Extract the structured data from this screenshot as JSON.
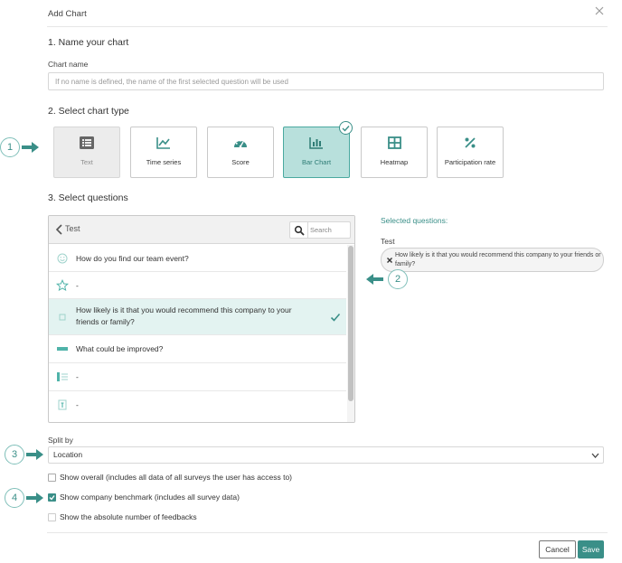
{
  "dialog": {
    "title": "Add Chart"
  },
  "section1": {
    "title": "1. Name your chart",
    "label": "Chart name",
    "placeholder": "If no name is defined, the name of the first selected question will be used",
    "value": ""
  },
  "section2": {
    "title": "2. Select chart type",
    "chart_types": [
      {
        "label": "Text",
        "icon": "list-icon",
        "state": "disabled"
      },
      {
        "label": "Time series",
        "icon": "line-chart-icon",
        "state": "normal"
      },
      {
        "label": "Score",
        "icon": "gauge-icon",
        "state": "normal"
      },
      {
        "label": "Bar Chart",
        "icon": "bar-chart-icon",
        "state": "selected"
      },
      {
        "label": "Heatmap",
        "icon": "grid-icon",
        "state": "normal"
      },
      {
        "label": "Participation rate",
        "icon": "percent-icon",
        "state": "normal"
      }
    ]
  },
  "section3": {
    "title": "3. Select questions",
    "panel": {
      "breadcrumb": "Test",
      "search_placeholder": "Search",
      "questions": [
        {
          "text": "How do you find our team event?",
          "icon": "smiley-icon",
          "selected": false
        },
        {
          "text": "-",
          "icon": "star-icon",
          "selected": false
        },
        {
          "text_line1": "How likely is it that you would recommend this company to your",
          "text_line2": "friends or family?",
          "icon": "nps-icon",
          "selected": true
        },
        {
          "text": "What could be improved?",
          "icon": "text-field-icon",
          "selected": false
        },
        {
          "text": "-",
          "icon": "matrix-icon",
          "selected": false
        },
        {
          "text": "-",
          "icon": "text-block-icon",
          "selected": false
        }
      ]
    },
    "selected": {
      "title": "Selected questions:",
      "group": "Test",
      "chip_text": "How likely is it that you would recommend this company to your friends or family?"
    }
  },
  "split_by": {
    "label": "Split by",
    "value": "Location"
  },
  "options": [
    {
      "label": "Show overall (includes all data of all surveys the user has access to)",
      "checked": false
    },
    {
      "label": "Show company benchmark (includes all survey data)",
      "checked": true
    },
    {
      "label": "Show the absolute number of feedbacks",
      "checked": false
    }
  ],
  "callouts": [
    "1",
    "2",
    "3",
    "4"
  ],
  "buttons": {
    "cancel": "Cancel",
    "save": "Save"
  },
  "colors": {
    "accent": "#3a8f88",
    "selected_card_bg": "#b8e0dc",
    "selected_row_bg": "#e3f3f1"
  }
}
